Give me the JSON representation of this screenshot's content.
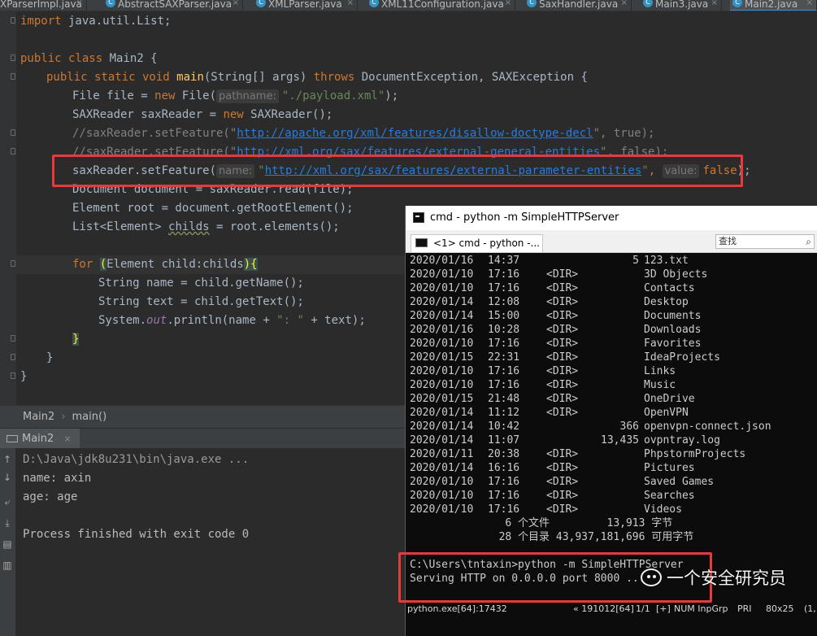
{
  "editor_tabs": [
    {
      "label": "XParserImpl.java",
      "icon": "C"
    },
    {
      "label": "AbstractSAXParser.java",
      "icon": "C"
    },
    {
      "label": "XMLParser.java",
      "icon": "C"
    },
    {
      "label": "XML11Configuration.java",
      "icon": "C"
    },
    {
      "label": "SaxHandler.java",
      "icon": "C"
    },
    {
      "label": "Main3.java",
      "icon": "C"
    },
    {
      "label": "Main2.java",
      "icon": "C"
    }
  ],
  "code": {
    "l1_kw": "import",
    "l1_rest": " java.util.List;",
    "l2_kw": "public class",
    "l2_rest": " Main2 {",
    "l3_kw1": "public static void",
    "l3_fn": "main",
    "l3_mid": "(String[] args) ",
    "l3_kw2": "throws",
    "l3_rest": " DocumentException, SAXException {",
    "l4_a": "File file = ",
    "l4_kw": "new",
    "l4_b": " File(",
    "l4_hint": "pathname:",
    "l4_str": "\"./payload.xml\"",
    "l4_c": ");",
    "l5_a": "SAXReader saxReader = ",
    "l5_kw": "new",
    "l5_b": " SAXReader();",
    "l6_a": "//saxReader.setFeature(\"",
    "l6_url": "http://apache.org/xml/features/disallow-doctype-decl",
    "l6_b": "\", true);",
    "l7_a": "//saxReader.setFeature(\"",
    "l7_url": "http://xml.org/sax/features/external-general-entities",
    "l7_b": "\", false);",
    "l8_a": "saxReader.setFeature(",
    "l8_hint1": "name:",
    "l8_q1": "\"",
    "l8_url": "http://xml.org/sax/features/external-parameter-entities",
    "l8_q2": "\"",
    "l8_comma": ", ",
    "l8_hint2": "value:",
    "l8_kw": "false",
    "l8_end": ");",
    "l9": "Document document = saxReader.read(file);",
    "l10": "Element root = document.getRootElement();",
    "l11_a": "List<Element> ",
    "l11_ul": "childs",
    "l11_b": " = root.elements();",
    "l12_kw": "for",
    "l12_b1": "(",
    "l12_mid": "Element child:childs",
    "l12_b2": "){",
    "l13": "String name = child.getName();",
    "l14": "String text = child.getText();",
    "l15_a": "System.",
    "l15_it": "out",
    "l15_b": ".println(name + ",
    "l15_str": "\": \"",
    "l15_c": " + text);",
    "l16": "}",
    "l17": "}",
    "l18": "}"
  },
  "breadcrumb": {
    "file": "Main2",
    "method": "main()"
  },
  "run": {
    "tab_label": "Main2",
    "cmd_line": "D:\\Java\\jdk8u231\\bin\\java.exe ...",
    "out1": "name: axin",
    "out2": "age: age",
    "finish": "Process finished with exit code 0"
  },
  "cmd": {
    "title": "cmd - python  -m SimpleHTTPServer",
    "tab_label": "<1> cmd - python  -...",
    "search_placeholder": "查找",
    "listing": [
      {
        "date": "2020/01/16",
        "time": "14:37",
        "dir": "",
        "size": "5",
        "name": "123.txt"
      },
      {
        "date": "2020/01/10",
        "time": "17:16",
        "dir": "<DIR>",
        "size": "",
        "name": "3D Objects"
      },
      {
        "date": "2020/01/10",
        "time": "17:16",
        "dir": "<DIR>",
        "size": "",
        "name": "Contacts"
      },
      {
        "date": "2020/01/14",
        "time": "12:08",
        "dir": "<DIR>",
        "size": "",
        "name": "Desktop"
      },
      {
        "date": "2020/01/14",
        "time": "15:00",
        "dir": "<DIR>",
        "size": "",
        "name": "Documents"
      },
      {
        "date": "2020/01/16",
        "time": "10:28",
        "dir": "<DIR>",
        "size": "",
        "name": "Downloads"
      },
      {
        "date": "2020/01/10",
        "time": "17:16",
        "dir": "<DIR>",
        "size": "",
        "name": "Favorites"
      },
      {
        "date": "2020/01/15",
        "time": "22:31",
        "dir": "<DIR>",
        "size": "",
        "name": "IdeaProjects"
      },
      {
        "date": "2020/01/10",
        "time": "17:16",
        "dir": "<DIR>",
        "size": "",
        "name": "Links"
      },
      {
        "date": "2020/01/10",
        "time": "17:16",
        "dir": "<DIR>",
        "size": "",
        "name": "Music"
      },
      {
        "date": "2020/01/15",
        "time": "21:48",
        "dir": "<DIR>",
        "size": "",
        "name": "OneDrive"
      },
      {
        "date": "2020/01/14",
        "time": "11:12",
        "dir": "<DIR>",
        "size": "",
        "name": "OpenVPN"
      },
      {
        "date": "2020/01/14",
        "time": "10:42",
        "dir": "",
        "size": "366",
        "name": "openvpn-connect.json"
      },
      {
        "date": "2020/01/14",
        "time": "11:07",
        "dir": "",
        "size": "13,435",
        "name": "ovpntray.log"
      },
      {
        "date": "2020/01/11",
        "time": "20:38",
        "dir": "<DIR>",
        "size": "",
        "name": "PhpstormProjects"
      },
      {
        "date": "2020/01/14",
        "time": "16:16",
        "dir": "<DIR>",
        "size": "",
        "name": "Pictures"
      },
      {
        "date": "2020/01/10",
        "time": "17:16",
        "dir": "<DIR>",
        "size": "",
        "name": "Saved Games"
      },
      {
        "date": "2020/01/10",
        "time": "17:16",
        "dir": "<DIR>",
        "size": "",
        "name": "Searches"
      },
      {
        "date": "2020/01/10",
        "time": "17:16",
        "dir": "<DIR>",
        "size": "",
        "name": "Videos"
      }
    ],
    "summary1": "               6 个文件         13,913 字节",
    "summary2": "              28 个目录 43,937,181,696 可用字节",
    "prompt": "C:\\Users\\tntaxin>python -m SimpleHTTPServer",
    "serving": "Serving HTTP on 0.0.0.0 port 8000 ...",
    "status": {
      "proc": "python.exe[64]:17432",
      "pos": "« 191012[64]",
      "pages": "1/1",
      "plus": "[+]",
      "caps": "NUM InpGrp",
      "pri": "PRI",
      "size": "80x25",
      "extra": "(1,"
    }
  },
  "watermark": "一个安全研究员"
}
